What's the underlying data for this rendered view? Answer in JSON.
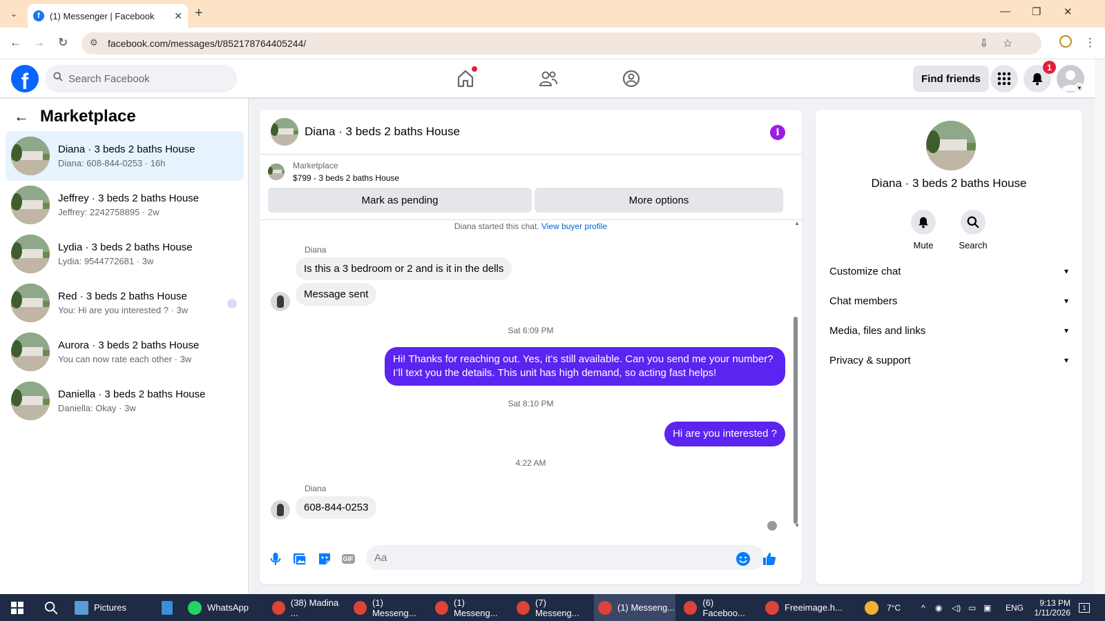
{
  "browser": {
    "tab_title": "(1) Messenger | Facebook",
    "url": "facebook.com/messages/t/852178764405244/"
  },
  "fb_header": {
    "search_placeholder": "Search Facebook",
    "find_friends": "Find friends",
    "notification_count": "1"
  },
  "sidebar": {
    "title": "Marketplace",
    "chats": [
      {
        "name": "Diana · 3 beds 2 baths House",
        "snippet": "Diana: 608-844-0253 · 16h"
      },
      {
        "name": "Jeffrey · 3 beds 2 baths House",
        "snippet": "Jeffrey: 2242758895 · 2w"
      },
      {
        "name": "Lydia · 3 beds 2 baths House",
        "snippet": "Lydia: 9544772681 · 3w"
      },
      {
        "name": "Red · 3 beds 2 baths House",
        "snippet": "You: Hi are you interested ? · 3w"
      },
      {
        "name": "Aurora · 3 beds 2 baths House",
        "snippet": "You can now rate each other · 3w"
      },
      {
        "name": "Daniella · 3 beds 2 baths House",
        "snippet": "Daniella: Okay · 3w"
      }
    ]
  },
  "conversation": {
    "title": "Diana · 3 beds 2 baths House",
    "listing_label": "Marketplace",
    "listing_price": "$799 - 3 beds 2 baths House",
    "mark_pending": "Mark as pending",
    "more_options": "More options",
    "started_note": "Diana started this chat.",
    "view_buyer": "View buyer profile",
    "messages": [
      {
        "sender": "Diana",
        "text": "Is this a 3 bedroom or 2 and is it in the dells"
      },
      {
        "text": "Message sent"
      },
      {
        "timestamp": "Sat 6:09 PM"
      },
      {
        "text": "Hi! Thanks for reaching out. Yes, it’s still available. Can you send me your number? I’ll text you the details. This unit has high demand, so acting fast helps!"
      },
      {
        "timestamp": "Sat 8:10 PM"
      },
      {
        "text": "Hi are you interested ?"
      },
      {
        "timestamp": "4:22 AM"
      },
      {
        "sender": "Diana",
        "text": "608-844-0253"
      }
    ],
    "input_placeholder": "Aa"
  },
  "info_panel": {
    "name": "Diana · 3 beds 2 baths House",
    "mute": "Mute",
    "search": "Search",
    "sections": [
      "Customize chat",
      "Chat members",
      "Media, files and links",
      "Privacy & support"
    ]
  },
  "taskbar": {
    "items": [
      "Pictures",
      "WhatsApp",
      "(38) Madina ...",
      "(1) Messeng...",
      "(1) Messeng...",
      "(7) Messeng...",
      "(1) Messeng...",
      "(6) Faceboo...",
      "Freeimage.h..."
    ],
    "temperature": "7°C",
    "language": "ENG",
    "time": "9:13 PM",
    "date": "1/11/2026",
    "notif_count": "1"
  },
  "colors": {
    "fb_blue": "#0866ff",
    "outgoing_bubble": "#5b24f0",
    "active_chat_bg": "#e7f3ff",
    "link_blue": "#0064d1"
  }
}
